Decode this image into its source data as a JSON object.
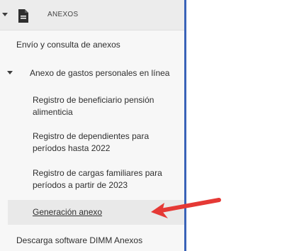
{
  "sidebar": {
    "section": {
      "icon": "document-icon",
      "label": "ANEXOS"
    },
    "items": [
      {
        "label": "Envío y consulta de anexos"
      },
      {
        "label": "Anexo de gastos personales en línea",
        "expanded": true
      },
      {
        "label": "Registro de beneficiario pensión alimenticia"
      },
      {
        "label": "Registro de dependientes para períodos hasta 2022"
      },
      {
        "label": "Registro de cargas familiares para períodos a partir de 2023"
      },
      {
        "label": "Generación anexo",
        "selected": true
      },
      {
        "label": "Descarga software DIMM Anexos"
      }
    ]
  },
  "annotation": {
    "icon": "red-arrow-icon",
    "color": "#e53935"
  },
  "colors": {
    "divider": "#3a63b8",
    "sidebar_bg": "#f7f7f7",
    "header_bg": "#ececec",
    "selected_bg": "#e9e9e9"
  }
}
